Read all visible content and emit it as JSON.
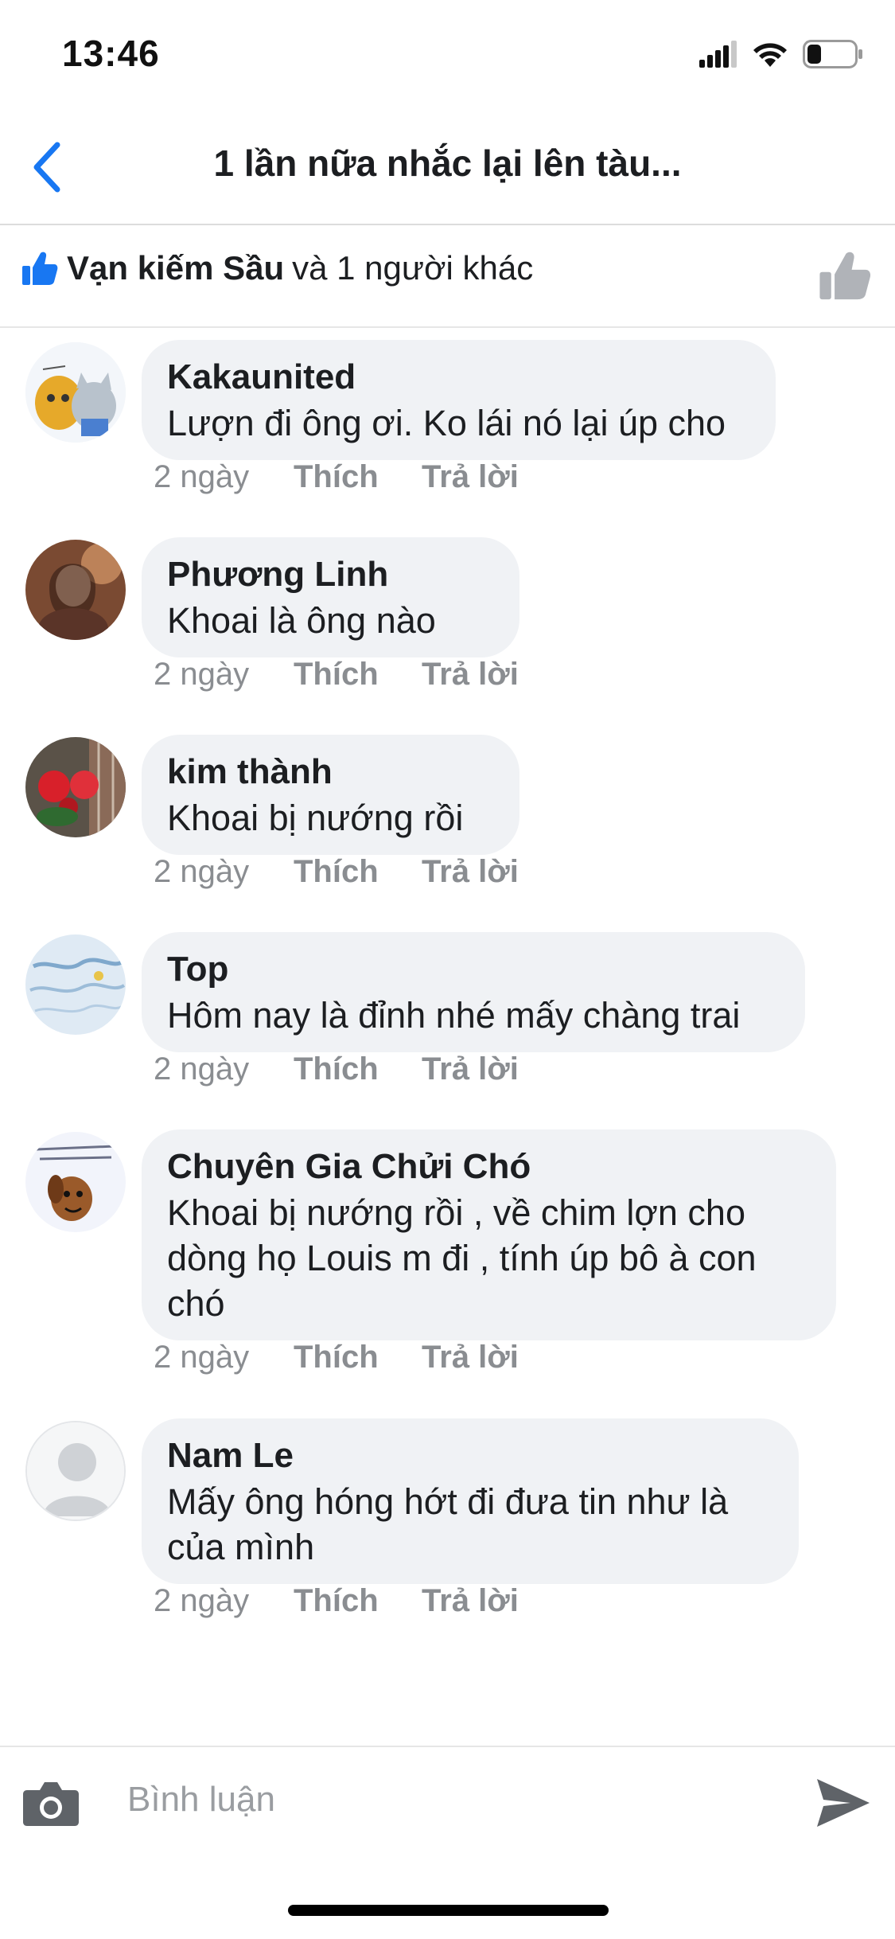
{
  "status_bar": {
    "time": "13:46",
    "battery_level": 0.3
  },
  "header": {
    "title": "1 lần nữa nhắc lại lên tàu..."
  },
  "likes": {
    "liker_name": "Vạn kiếm Sầu",
    "others_text": "và 1 người khác"
  },
  "comments": [
    {
      "author": "Kakaunited",
      "text": "Lượn đi ông ơi. Ko lái nó lại úp cho",
      "time": "2 ngày",
      "like_label": "Thích",
      "reply_label": "Trả lời"
    },
    {
      "author": "Phương Linh",
      "text": "Khoai là ông nào",
      "time": "2 ngày",
      "like_label": "Thích",
      "reply_label": "Trả lời"
    },
    {
      "author": "kim thành",
      "text": "Khoai bị nướng rồi",
      "time": "2 ngày",
      "like_label": "Thích",
      "reply_label": "Trả lời"
    },
    {
      "author": "Top",
      "text": "Hôm nay là đỉnh nhé mấy chàng trai",
      "time": "2 ngày",
      "like_label": "Thích",
      "reply_label": "Trả lời"
    },
    {
      "author": "Chuyên Gia Chửi Chó",
      "text": "Khoai bị nướng rồi , về chim lợn cho dòng họ Louis m đi , tính úp bô à con chó",
      "time": "2 ngày",
      "like_label": "Thích",
      "reply_label": "Trả lời"
    },
    {
      "author": "Nam Le",
      "text": "Mấy ông hóng hớt đi đưa tin như là của mình",
      "time": "2 ngày",
      "like_label": "Thích",
      "reply_label": "Trả lời"
    }
  ],
  "composer": {
    "placeholder": "Bình luận"
  },
  "colors": {
    "accent": "#1877f2",
    "bubble": "#f0f2f5",
    "meta_text": "#8a8d91"
  }
}
